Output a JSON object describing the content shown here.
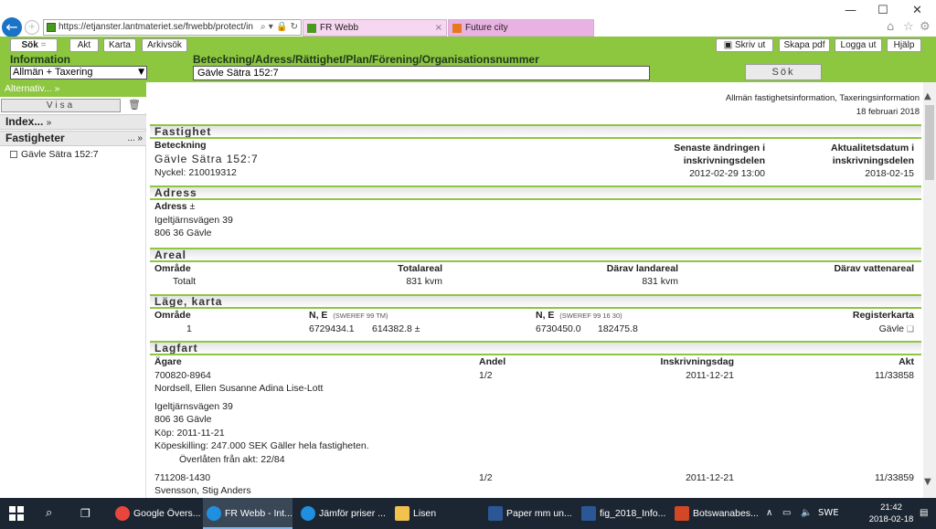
{
  "browser": {
    "url": "https://etjanster.lantmateriet.se/frwebb/protect/in",
    "tabs": [
      {
        "label": "FR Webb",
        "close": "×"
      },
      {
        "label": "Future city"
      }
    ],
    "window_controls": {
      "minimize": "—",
      "maximize": "☐",
      "close": "✕"
    }
  },
  "toolbar": {
    "left_buttons": [
      "Sök",
      "Akt",
      "Karta",
      "Arkivsök"
    ],
    "right_buttons": [
      "Skriv ut",
      "Skapa pdf",
      "Logga ut",
      "Hjälp"
    ]
  },
  "search": {
    "info_label": "Information",
    "info_selected": "Allmän + Taxering",
    "query_label": "Beteckning/Adress/Rättighet/Plan/Förening/Organisationsnummer",
    "query_value": "Gävle Sätra 152:7",
    "submit_label": "Sök"
  },
  "sidebar": {
    "alternativ": "Alternativ... »",
    "visa": "Visa",
    "index": "Index...",
    "index_arrow": "»",
    "fastigheter": "Fastigheter",
    "fastigheter_more": "... »",
    "item": "Gävle Sätra 152:7"
  },
  "report": {
    "header_line1": "Allmän fastighetsinformation, Taxeringsinformation",
    "header_line2": "18 februari 2018",
    "fastighet": {
      "title": "Fastighet",
      "beteckning_label": "Beteckning",
      "beteckning": "Gävle Sätra 152:7",
      "nyckel": "Nyckel:  210019312",
      "senaste_label1": "Senaste ändringen i",
      "senaste_label2": "inskrivningsdelen",
      "senaste_value": "2012-02-29 13:00",
      "aktualitet_label1": "Aktualitetsdatum i",
      "aktualitet_label2": "inskrivningsdelen",
      "aktualitet_value": "2018-02-15"
    },
    "adress": {
      "title": "Adress",
      "label": "Adress",
      "toggle": "±",
      "line1": "Igeltjärnsvägen 39",
      "line2": "806 36 Gävle"
    },
    "areal": {
      "title": "Areal",
      "cols": [
        "Område",
        "Totalareal",
        "Därav landareal",
        "Därav vattenareal"
      ],
      "row": [
        "Totalt",
        "831 kvm",
        "831 kvm",
        ""
      ]
    },
    "lage": {
      "title": "Läge, karta",
      "col_omrade": "Område",
      "col_ne1": "N, E",
      "col_ne1_sys": "(SWEREF 99 TM)",
      "col_ne2": "N, E",
      "col_ne2_sys": "(SWEREF 99 16 30)",
      "col_register": "Registerkarta",
      "row_omrade": "1",
      "n1": "6729434.1",
      "e1": "614382.8",
      "toggle": "±",
      "n2": "6730450.0",
      "e2": "182475.8",
      "register": "Gävle",
      "register_icon": "❑"
    },
    "lagfart": {
      "title": "Lagfart",
      "cols": [
        "Ägare",
        "Andel",
        "Inskrivningsdag",
        "Akt"
      ],
      "owners": [
        {
          "id": "700820-8964",
          "name": "Nordsell, Ellen Susanne Adina Lise-Lott",
          "andel": "1/2",
          "dag": "2011-12-21",
          "akt": "11/33858",
          "addr1": "Igeltjärnsvägen 39",
          "addr2": "806 36 Gävle",
          "kop": "Köp:  2011-11-21",
          "kopeskilling": "Köpeskilling:  247.000 SEK Gäller hela fastigheten.",
          "overlaten": "Överlåten från akt:   22/84"
        },
        {
          "id": "711208-1430",
          "name": "Svensson, Stig Anders",
          "andel": "1/2",
          "dag": "2011-12-21",
          "akt": "11/33859"
        }
      ]
    }
  },
  "taskbar": {
    "items": [
      {
        "label": "Google Övers...",
        "color": "#e8453c"
      },
      {
        "label": "FR Webb - Int...",
        "color": "#1f8fe0"
      },
      {
        "label": "Jämför priser ...",
        "color": "#1f8fe0"
      },
      {
        "label": "Lisen",
        "color": "#f2c14e"
      },
      {
        "label": "Paper mm un...",
        "color": "#2b5797"
      },
      {
        "label": "fig_2018_Info...",
        "color": "#2b5797"
      },
      {
        "label": "Botswanabes...",
        "color": "#d24726"
      }
    ],
    "lang": "SWE",
    "time": "21:42",
    "date": "2018-02-18"
  }
}
